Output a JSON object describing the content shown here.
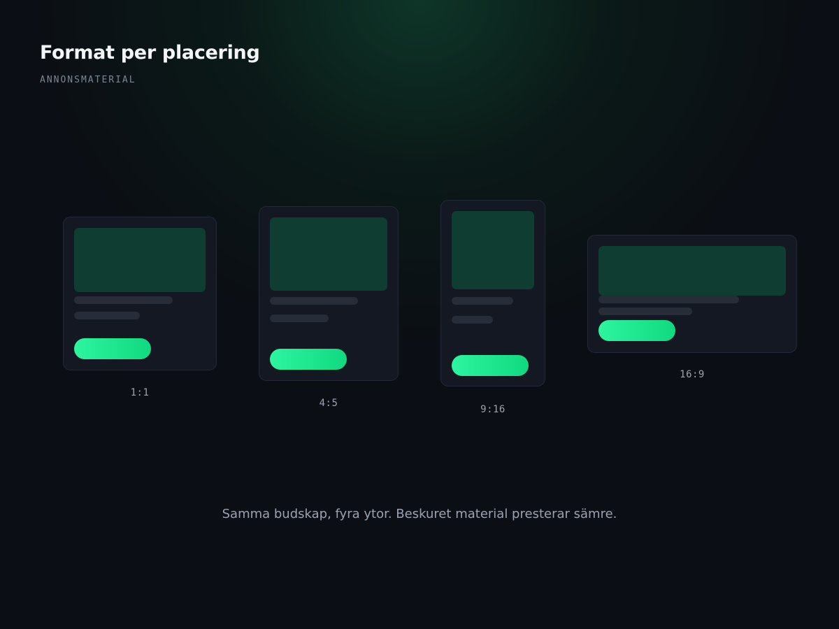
{
  "header": {
    "title": "Format per placering",
    "subtitle": "ANNONSMATERIAL"
  },
  "formats": [
    {
      "ratio": "1:1"
    },
    {
      "ratio": "4:5"
    },
    {
      "ratio": "9:16"
    },
    {
      "ratio": "16:9"
    }
  ],
  "caption": "Samma budskap, fyra ytor. Beskuret material presterar sämre.",
  "colors": {
    "background": "#0b0e14",
    "glow": "#0e3a2a",
    "card": "#141822",
    "card_border": "#232936",
    "media": "#0f3d31",
    "text_line": "#262c38",
    "cta_start": "#2df5a0",
    "cta_end": "#10d97f",
    "title": "#f3f5f7",
    "muted": "#9aa3b2"
  }
}
